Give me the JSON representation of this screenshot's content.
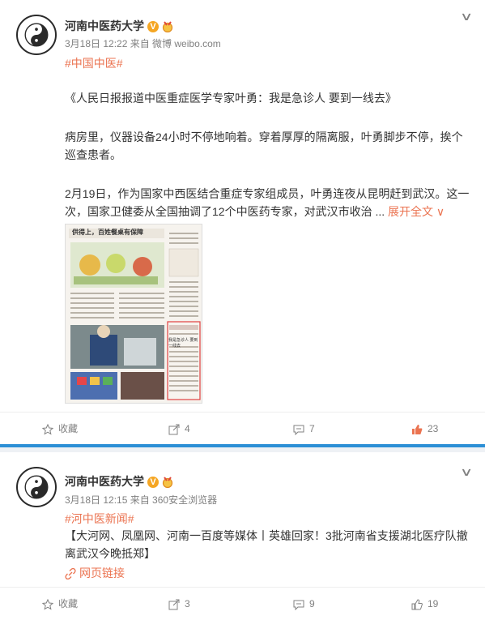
{
  "posts": [
    {
      "user": "河南中医药大学",
      "meta": "3月18日 12:22 来自 微博 weibo.com",
      "topic": "#中国中医#",
      "title": "《人民日报报道中医重症医学专家叶勇：我是急诊人 要到一线去》",
      "p1": "病房里，仪器设备24小时不停地响着。穿着厚厚的隔离服，叶勇脚步不停，挨个巡查患者。",
      "p2": "2月19日，作为国家中西医结合重症专家组成员，叶勇连夜从昆明赶到武汉。这一次，国家卫健委从全国抽调了12个中医药专家，对武汉市收治 ...",
      "expand": "展开全文",
      "image": {
        "headline": "供得上，百姓餐桌有保障",
        "boxed_text": "我是急诊人 要到一线去"
      },
      "actions": {
        "favorite": "收藏",
        "repost": "4",
        "comment": "7",
        "like": "23"
      }
    },
    {
      "user": "河南中医药大学",
      "meta": "3月18日 12:15 来自 360安全浏览器",
      "topic": "#河中医新闻#",
      "text": "【大河网、凤凰网、河南一百度等媒体丨英雄回家！3批河南省支援湖北医疗队撤离武汉今晚抵郑】",
      "link": "网页链接",
      "actions": {
        "favorite": "收藏",
        "repost": "3",
        "comment": "9",
        "like": "19"
      }
    }
  ],
  "colors": {
    "accent": "#eb7350",
    "like_active": "#eb7350",
    "separator": "#2c8fd6"
  },
  "icons": [
    "avatar-logo",
    "verified-icon",
    "medal-icon",
    "chevron-down-icon",
    "star-icon",
    "repost-icon",
    "comment-icon",
    "like-icon",
    "link-icon"
  ]
}
